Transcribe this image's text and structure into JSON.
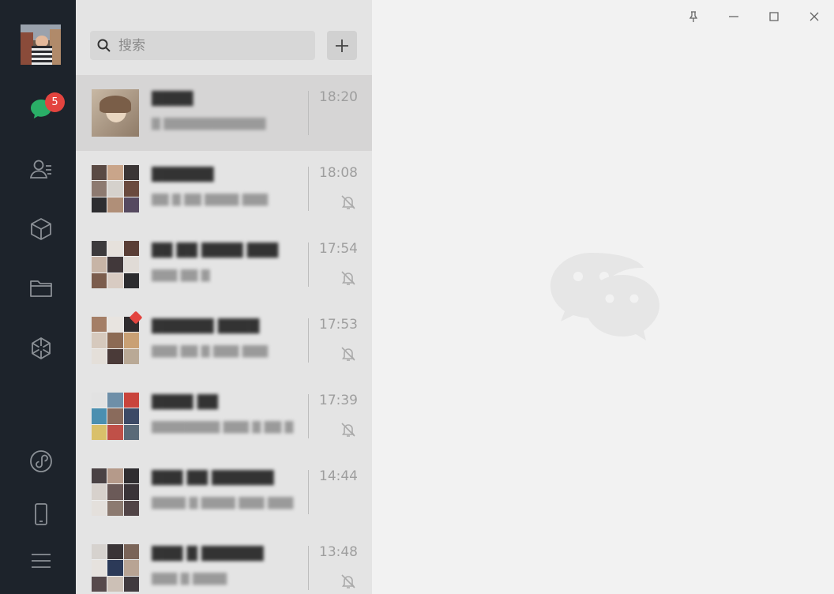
{
  "sidebar": {
    "chat_badge": "5",
    "items": [
      {
        "name": "chat",
        "icon": "chat-bubble-icon"
      },
      {
        "name": "contacts",
        "icon": "contacts-icon"
      },
      {
        "name": "favorites",
        "icon": "cube-icon"
      },
      {
        "name": "files",
        "icon": "folder-icon"
      },
      {
        "name": "moments",
        "icon": "moments-shutter-icon"
      },
      {
        "name": "mini-programs",
        "icon": "mini-program-icon"
      },
      {
        "name": "phone",
        "icon": "phone-icon"
      },
      {
        "name": "menu",
        "icon": "hamburger-menu-icon"
      }
    ]
  },
  "search": {
    "placeholder": "搜索"
  },
  "chats": [
    {
      "name": "████",
      "preview": "█ ████████████",
      "time": "18:20",
      "muted": false
    },
    {
      "name": "██████",
      "preview": "██ █ ██ ████ ███",
      "time": "18:08",
      "muted": true
    },
    {
      "name": "██ ██ ████ ███",
      "preview": "███ ██ █",
      "time": "17:54",
      "muted": true
    },
    {
      "name": "██████ ████",
      "preview": "███ ██ █ ███ ███",
      "time": "17:53",
      "muted": true
    },
    {
      "name": "████ ██",
      "preview": "████████ ███ █ ██ █",
      "time": "17:39",
      "muted": true
    },
    {
      "name": "███ ██ ██████",
      "preview": "████ █ ████ ███ ███",
      "time": "14:44",
      "muted": false
    },
    {
      "name": "███ █ ██████",
      "preview": "███ █ ████",
      "time": "13:48",
      "muted": true
    }
  ],
  "colors": {
    "rail_bg": "#1d232b",
    "list_bg": "#e4e4e4",
    "main_bg": "#f2f2f2",
    "badge": "#e3443f",
    "wechat_green": "#2aae67"
  }
}
